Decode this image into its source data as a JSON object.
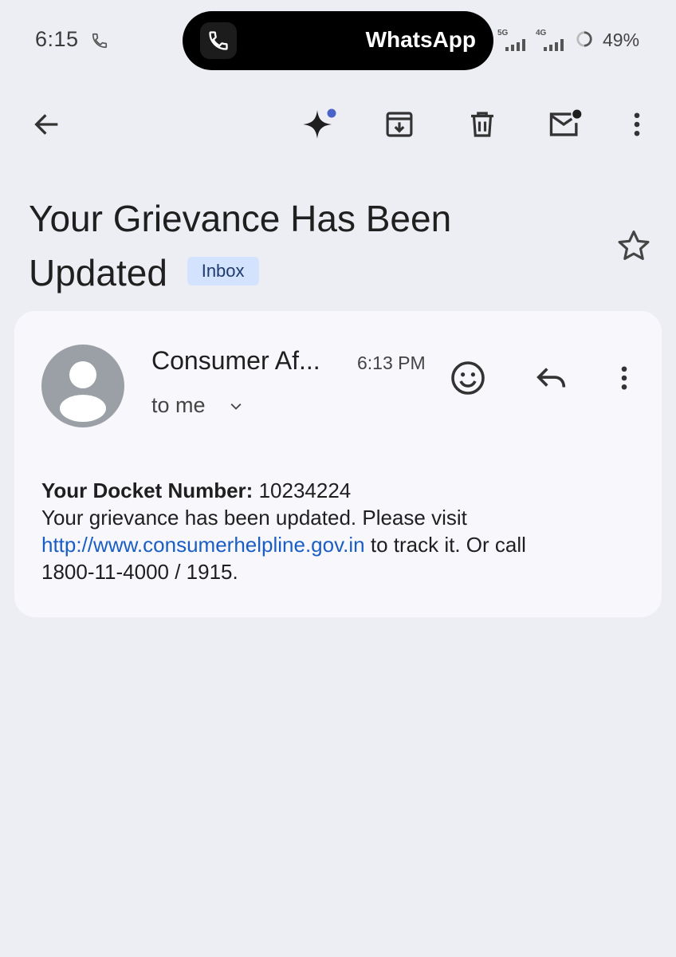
{
  "status_bar": {
    "time": "6:15",
    "pill_app": "WhatsApp",
    "network_1": "5G",
    "network_2": "4G",
    "battery": "49%",
    "icons": [
      "call-icon",
      "whatsapp-call-icon",
      "signal-icon",
      "battery-icon"
    ]
  },
  "toolbar": {
    "icons": [
      "back-arrow-icon",
      "gemini-sparkle-icon",
      "archive-icon",
      "delete-icon",
      "mark-unread-icon",
      "more-vert-icon"
    ]
  },
  "email": {
    "subject": "Your Grievance Has Been Updated",
    "label": "Inbox",
    "sender": "Consumer Af...",
    "time": "6:13 PM",
    "recipient": "to me",
    "docket_label": "Your Docket Number:",
    "docket_number": "10234224",
    "body_line_1": "Your grievance has been updated. Please visit",
    "link": "http://www.consumerhelpline.gov.in",
    "body_after_link": "to track it. Or call",
    "phone": "1800-11-4000 / 1915."
  },
  "colors": {
    "background": "#ededf4",
    "card": "#f7f7fc",
    "chip": "#d3e3fd",
    "link": "#1a5ec4",
    "gemini_dot": "#4a63c9"
  }
}
